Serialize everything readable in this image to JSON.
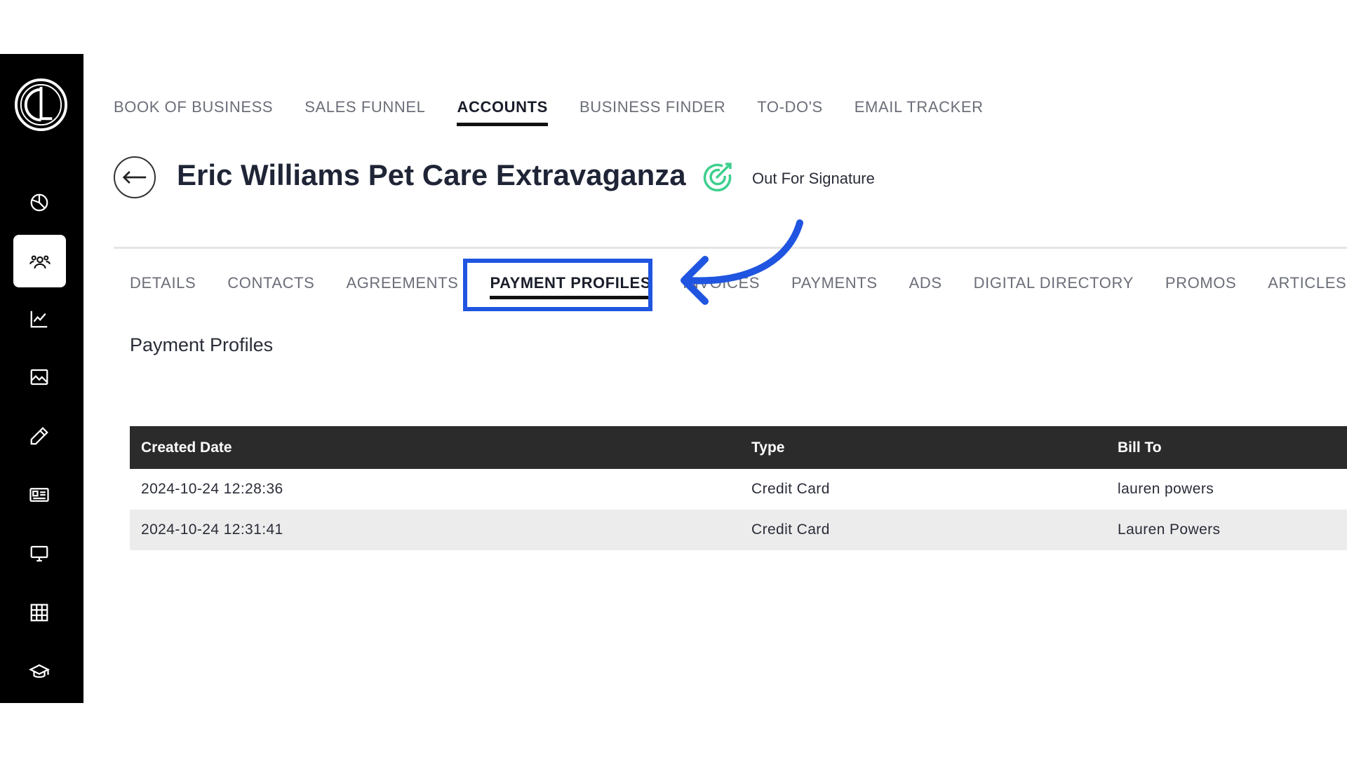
{
  "topnav": {
    "items": [
      {
        "label": "BOOK OF BUSINESS"
      },
      {
        "label": "SALES FUNNEL"
      },
      {
        "label": "ACCOUNTS",
        "active": true
      },
      {
        "label": "BUSINESS FINDER"
      },
      {
        "label": "TO-DO'S"
      },
      {
        "label": "EMAIL TRACKER"
      }
    ]
  },
  "header": {
    "title": "Eric Williams Pet Care Extravaganza",
    "status": "Out For Signature",
    "status_color": "#3ecf8e"
  },
  "subtabs": {
    "items": [
      {
        "label": "DETAILS"
      },
      {
        "label": "CONTACTS"
      },
      {
        "label": "AGREEMENTS"
      },
      {
        "label": "PAYMENT PROFILES",
        "active": true
      },
      {
        "label": "INVOICES"
      },
      {
        "label": "PAYMENTS"
      },
      {
        "label": "ADS"
      },
      {
        "label": "DIGITAL DIRECTORY"
      },
      {
        "label": "PROMOS"
      },
      {
        "label": "ARTICLES"
      }
    ]
  },
  "section": {
    "title": "Payment Profiles"
  },
  "table": {
    "headers": [
      "Created Date",
      "Type",
      "Bill To"
    ],
    "rows": [
      [
        "2024-10-24 12:28:36",
        "Credit Card",
        "lauren powers"
      ],
      [
        "2024-10-24 12:31:41",
        "Credit Card",
        "Lauren Powers"
      ]
    ]
  },
  "sidebar": {
    "icons": [
      "logo-icon",
      "pie-chart-icon",
      "users-icon",
      "line-chart-icon",
      "image-icon",
      "pencil-icon",
      "id-card-icon",
      "monitor-icon",
      "grid-icon",
      "graduation-cap-icon"
    ],
    "active": "users-icon"
  },
  "colors": {
    "highlight": "#1f55e0",
    "sidebar_bg": "#000000",
    "table_header_bg": "#2b2b2b"
  }
}
